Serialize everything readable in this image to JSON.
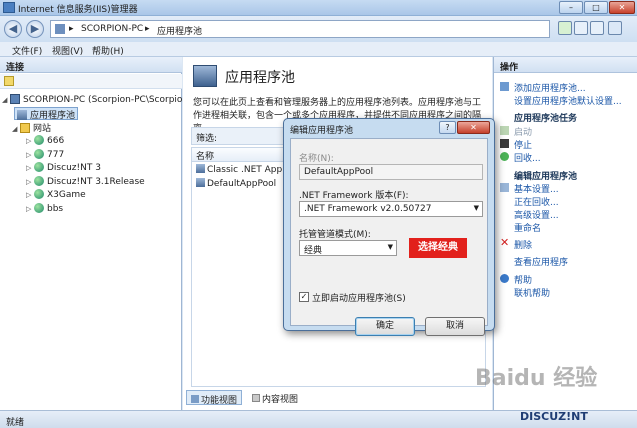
{
  "window": {
    "title": "Internet 信息服务(IIS)管理器",
    "buttons": {
      "minimize": "–",
      "maximize": "□",
      "close": "✕"
    }
  },
  "address": {
    "back": "◀",
    "forward": "▶",
    "segment_1": "SCORPION-PC",
    "separator": "▸",
    "segment_2": "应用程序池"
  },
  "menu": [
    "文件(F)",
    "视图(V)",
    "帮助(H)"
  ],
  "connections": {
    "header": "连接",
    "tree": [
      {
        "label": "SCORPION-PC (Scorpion-PC\\Scorpion)"
      },
      {
        "label": "应用程序池"
      },
      {
        "label": "网站"
      },
      {
        "label": "666"
      },
      {
        "label": "777"
      },
      {
        "label": "Discuz!NT 3"
      },
      {
        "label": "Discuz!NT 3.1Release"
      },
      {
        "label": "X3Game"
      },
      {
        "label": "bbs"
      }
    ]
  },
  "center": {
    "title": "应用程序池",
    "description": "您可以在此页上查看和管理服务器上的应用程序池列表。应用程序池与工作进程相关联，包含一个或多个应用程序，并提供不同应用程序之间的隔离。",
    "filter_label": "筛选:",
    "column_name": "名称",
    "rows": [
      "Classic .NET AppPo",
      "DefaultAppPool"
    ],
    "tabs": {
      "feature_view": "功能视图",
      "content_view": "内容视图"
    }
  },
  "actions": {
    "header": "操作",
    "add_pool": "添加应用程序池...",
    "set_defaults": "设置应用程序池默认设置...",
    "tasks_header": "应用程序池任务",
    "start": "启动",
    "stop": "停止",
    "recycle": "回收...",
    "edit_header": "编辑应用程序池",
    "basic_settings": "基本设置...",
    "recycling": "正在回收...",
    "advanced_settings": "高级设置...",
    "rename": "重命名",
    "delete": "删除",
    "view_apps": "查看应用程序",
    "help": "帮助",
    "online_help": "联机帮助"
  },
  "status": {
    "text": "就绪"
  },
  "dialog": {
    "title": "编辑应用程序池",
    "help_btn": "?",
    "close_btn": "✕",
    "name_label": "名称(N):",
    "name_value": "DefaultAppPool",
    "framework_label": ".NET Framework 版本(F):",
    "framework_value": ".NET Framework v2.0.50727",
    "pipeline_label": "托管管道模式(M):",
    "pipeline_value": "经典",
    "annotation": "选择经典",
    "autostart_checked": "✓",
    "autostart_label": "立即启动应用程序池(S)",
    "ok": "确定",
    "cancel": "取消"
  },
  "watermark": {
    "brand": "Baidu 经验",
    "site": "DISCUZ!NT"
  }
}
